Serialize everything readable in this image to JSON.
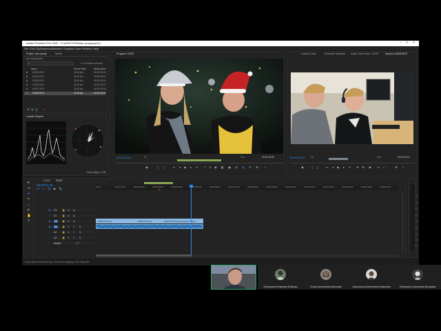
{
  "window": {
    "title": "Adobe Premiere Pro 2020 - C:\\АНИТУЛОК\\мы лучшу.prproj *",
    "controls": [
      "–",
      "□",
      "×"
    ]
  },
  "menu": [
    "File",
    "Edit",
    "Clip",
    "Sequence",
    "Markers",
    "Graphics",
    "View",
    "Window",
    "Help"
  ],
  "project_panel": {
    "tabs": [
      "Project: мы лучшу",
      "Media"
    ],
    "path": "мы лучшу.prproj",
    "search_placeholder": "",
    "selection_info": "1 of 18 items selected",
    "columns": [
      "Name",
      "Frame Rate",
      "Media Start"
    ],
    "items": [
      {
        "name": "01303.MTS",
        "fps": "25,00 fps",
        "start": "00:00:00:00",
        "selected": false
      },
      {
        "name": "01304.MTS",
        "fps": "25,00 fps",
        "start": "00:00:00:00",
        "selected": false
      },
      {
        "name": "01305.MTS",
        "fps": "25,00 fps",
        "start": "00:00:00:00",
        "selected": false
      },
      {
        "name": "01306.MTS",
        "fps": "25,00 fps",
        "start": "00:00:00:00",
        "selected": false
      },
      {
        "name": "01307.MTS",
        "fps": "25,00 fps",
        "start": "00:00:00:00",
        "selected": false
      },
      {
        "name": "01308.MTS",
        "fps": "25,00 fps",
        "start": "00:00:00:00",
        "selected": true
      }
    ]
  },
  "lumetri": {
    "tab": "Lumetri Scopes",
    "clamp_label": "Clamp Signal",
    "bit_label": "8 Bit"
  },
  "program_monitor": {
    "tab": "Program: 01307",
    "timecode_left": "00:00:04:16",
    "fit": "Fit",
    "quality": "Full",
    "timecode_right": "00:00:05:08"
  },
  "source_monitor": {
    "tabs": [
      "Lumetri Color",
      "Essential Graphics",
      "Audio Track Mixer: 01307",
      "Source: 01303.MTS"
    ],
    "timecode_left": "00:00:01:24",
    "fit": "Fit",
    "quality": "Full",
    "timecode_right": "00:00:00:22"
  },
  "timeline": {
    "tabs": [
      "01303",
      "01307"
    ],
    "playhead": "00:00:04:16",
    "ruler": [
      "00:00",
      "00:00:01:00",
      "00:00:02:00",
      "00:00:03:00",
      "00:00:04:00",
      "00:00:05:00",
      "00:00:06:00",
      "00:00:07:00",
      "00:00:08:00",
      "00:00:09:00",
      "00:00:10:00",
      "00:00:11:00",
      "00:00:12:00",
      "00:00:13:00",
      "00:00:14:00",
      "00:00:15:00"
    ],
    "tracks": [
      "V3",
      "V2",
      "V1",
      "A1",
      "A2",
      "A3"
    ],
    "mix_label": "Master",
    "mix_value": "0.0",
    "clips": [
      {
        "name": "01303.MTS [V]"
      },
      {
        "name": "01303.MTS [V]"
      },
      {
        "name": "01307.MTS [V] [Composite Video]"
      }
    ],
    "meter_labels": [
      "0",
      "-6",
      "-12",
      "-18",
      "-24",
      "-30",
      "-36",
      "-42",
      "-48",
      "-54",
      "dB"
    ]
  },
  "status_bar": "Drag edge to trim incoming, Ctrl to trim outgoing; Alt to drag edit...",
  "participants": [
    {
      "name": ""
    },
    {
      "name": "Екатерина Игоревна Бойкова"
    },
    {
      "name": "Юлия Алексеевна Волкова"
    },
    {
      "name": "Анастасия Алексеевна Ковалева"
    },
    {
      "name": "Екатерина Сергеевна Бутакова"
    }
  ],
  "colors": {
    "accent": "#2d8ceb",
    "clip_blue": "#8cb8e6",
    "audio_clip": "#3e87c8",
    "panel": "#232323",
    "active_speaker": "#2fa866"
  }
}
